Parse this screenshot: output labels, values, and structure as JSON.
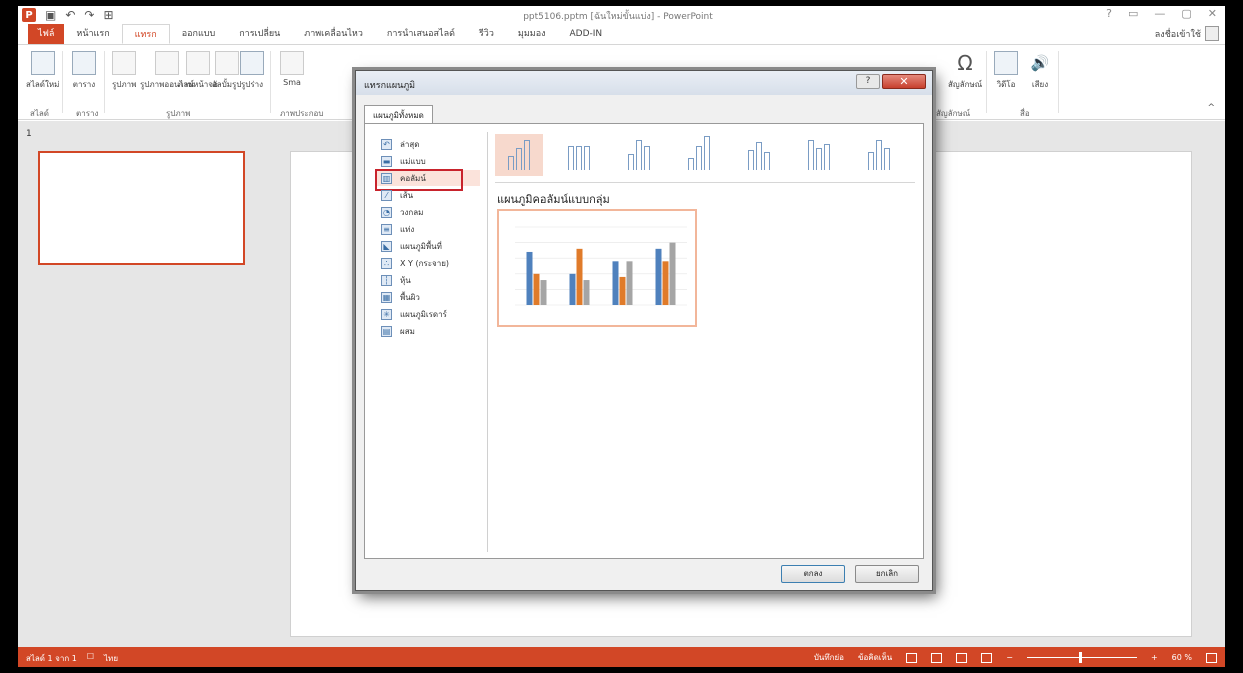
{
  "window": {
    "title": "ppt5106.pptm [ฉันใหม่ขั้นแบ่ง] - PowerPoint",
    "app_icon": "P",
    "controls": [
      "?",
      "▭",
      "—",
      "▢",
      "✕"
    ]
  },
  "qat": {
    "save_icon": "save-icon",
    "undo": "↶",
    "redo": "↷"
  },
  "tabs": [
    "ไฟล์",
    "หน้าแรก",
    "แทรก",
    "ออกแบบ",
    "การเปลี่ยน",
    "ภาพเคลื่อนไหว",
    "การนำเสนอสไลด์",
    "รีวิว",
    "มุมมอง",
    "ADD-IN"
  ],
  "active_tab_index": 2,
  "signin": "ลงชื่อเข้าใช้",
  "ribbon": {
    "buttons": [
      "สไลด์ใหม่",
      "ตาราง",
      "รูปภาพ",
      "รูปภาพออนไลน์",
      "ภาพหน้าจอ",
      "อัลบั้มรูป",
      "รูปร่าง",
      "Sma",
      "สัญลักษณ์",
      "วิดีโอ",
      "เสียง"
    ],
    "groups": [
      "สไลด์",
      "ตาราง",
      "รูปภาพ",
      "ภาพประกอบ",
      "สัญลักษณ์",
      "สื่อ"
    ],
    "omega": "Ω",
    "speaker": "🔊",
    "collapse": "^"
  },
  "thumbnail_number": "1",
  "statusbar": {
    "left": "สไลด์ 1 จาก 1",
    "lang": "ไทย",
    "notes": "บันทึกย่อ",
    "comments": "ข้อคิดเห็น",
    "zoom": "60 %"
  },
  "dialog": {
    "title": "แทรกแผนภูมิ",
    "help": "?",
    "close": "✕",
    "tab": "แผนภูมิทั้งหมด",
    "chart_types": [
      {
        "icon": "recent-icon",
        "glyph": "↶",
        "label": "ล่าสุด"
      },
      {
        "icon": "templates-icon",
        "glyph": "▬",
        "label": "แม่แบบ"
      },
      {
        "icon": "column-chart-icon",
        "glyph": "▥",
        "label": "คอลัมน์"
      },
      {
        "icon": "line-chart-icon",
        "glyph": "⁄",
        "label": "เส้น"
      },
      {
        "icon": "pie-chart-icon",
        "glyph": "◔",
        "label": "วงกลม"
      },
      {
        "icon": "bar-chart-icon",
        "glyph": "≡",
        "label": "แท่ง"
      },
      {
        "icon": "area-chart-icon",
        "glyph": "◣",
        "label": "แผนภูมิพื้นที่"
      },
      {
        "icon": "scatter-chart-icon",
        "glyph": "∴",
        "label": "X Y (กระจาย)"
      },
      {
        "icon": "stock-chart-icon",
        "glyph": "┆",
        "label": "หุ้น"
      },
      {
        "icon": "surface-chart-icon",
        "glyph": "▦",
        "label": "พื้นผิว"
      },
      {
        "icon": "radar-chart-icon",
        "glyph": "✳",
        "label": "แผนภูมิเรดาร์"
      },
      {
        "icon": "combo-chart-icon",
        "glyph": "▤",
        "label": "ผสม"
      }
    ],
    "selected_type_index": 2,
    "subtype_count": 7,
    "selected_subtype_index": 0,
    "subtype_name": "แผนภูมิคอลัมน์แบบกลุ่ม",
    "ok": "ตกลง",
    "cancel": "ยกเลิก"
  },
  "preview_colors": [
    "#4f81bd",
    "#e07b2a",
    "#a5a5a5"
  ],
  "preview_values": [
    [
      3.4,
      2.0,
      1.6
    ],
    [
      2.0,
      3.6,
      1.6
    ],
    [
      2.8,
      1.8,
      2.8
    ],
    [
      3.6,
      2.8,
      4.0
    ]
  ],
  "preview_ylim": [
    0,
    5
  ],
  "chart_data": {
    "type": "bar",
    "categories": [
      "",
      "",
      "",
      ""
    ],
    "series": [
      {
        "values": [
          3.4,
          2.0,
          2.8,
          3.6
        ]
      },
      {
        "values": [
          2.0,
          3.6,
          1.8,
          2.8
        ]
      },
      {
        "values": [
          1.6,
          1.6,
          2.8,
          4.0
        ]
      }
    ],
    "ylim": [
      0,
      5
    ]
  }
}
